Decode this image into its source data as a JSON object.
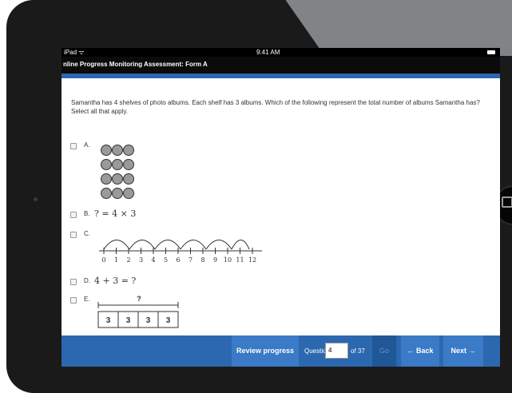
{
  "status_bar": {
    "device": "iPad ᯤ",
    "time": "9:41 AM"
  },
  "app": {
    "title": "nline Progress Monitoring Assessment: Form A"
  },
  "question": {
    "text": "Samantha has 4 shelves of photo albums. Each shelf has 3 albums. Which of the following represent the total number of albums Samantha has? Select all that apply.",
    "options": [
      {
        "label": "A."
      },
      {
        "label": "B.",
        "math": "? = 4 × 3"
      },
      {
        "label": "C."
      },
      {
        "label": "D.",
        "math": "4 + 3 = ?"
      },
      {
        "label": "E."
      }
    ],
    "number_line_labels": [
      "0",
      "1",
      "2",
      "3",
      "4",
      "5",
      "6",
      "7",
      "8",
      "9",
      "10",
      "11",
      "12"
    ],
    "tape": {
      "question_mark": "?",
      "cells": [
        "3",
        "3",
        "3",
        "3"
      ]
    }
  },
  "footer": {
    "review_label": "Review progress",
    "question_label": "Question",
    "question_value": "4",
    "of_label": "of 37",
    "go_label": "Go",
    "back_label": "← Back",
    "next_label": "Next →"
  },
  "colors": {
    "accent": "#2c68b0",
    "button": "#3a7ac6"
  }
}
